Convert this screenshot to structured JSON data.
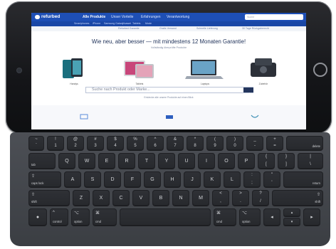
{
  "tablet": {
    "brand": "refurbed",
    "nav": [
      "Alle Produkte",
      "Unser Vorteile",
      "Erfahrungen",
      "Verantwortung"
    ],
    "search_placeholder": "Suche",
    "subnav": [
      "Smartphones",
      "iPhone",
      "Samsung Galaxy",
      "Huawei",
      "Tablets",
      "Mode"
    ],
    "pills": [
      "Refurbed Garantie",
      "Gratis Versand",
      "Schnelle Lieferung",
      "30 Tage Rückgaberecht"
    ],
    "headline": "Wie neu, aber besser — mit mindestens 12 Monaten Garantie!",
    "subheadline": "Vollständig überprüfte Produkte",
    "categories": [
      {
        "label": "Handys",
        "color": "#1a6f7e"
      },
      {
        "label": "Tablets",
        "color": "#c8467a"
      },
      {
        "label": "Laptops",
        "color": "#7f8a96"
      },
      {
        "label": "Zubehör",
        "color": "#2c3038"
      }
    ],
    "search_bar": "Suche nach Produkt oder Marke...",
    "hint": "Entdecke alle unsere Produkte auf einen Blick",
    "icon_colors": {
      "brand": "#1e4fb5",
      "text": "#23355c"
    }
  },
  "keyboard": {
    "row1": [
      {
        "top": "~",
        "bot": "`"
      },
      {
        "top": "!",
        "bot": "1"
      },
      {
        "top": "@",
        "bot": "2"
      },
      {
        "top": "#",
        "bot": "3"
      },
      {
        "top": "$",
        "bot": "4"
      },
      {
        "top": "%",
        "bot": "5"
      },
      {
        "top": "^",
        "bot": "6"
      },
      {
        "top": "&",
        "bot": "7"
      },
      {
        "top": "*",
        "bot": "8"
      },
      {
        "top": "(",
        "bot": "9"
      },
      {
        "top": ")",
        "bot": "0"
      },
      {
        "top": "_",
        "bot": "-"
      },
      {
        "top": "+",
        "bot": "="
      }
    ],
    "delete": "delete",
    "tab": "tab",
    "row2": [
      "Q",
      "W",
      "E",
      "R",
      "T",
      "Y",
      "U",
      "I",
      "O",
      "P"
    ],
    "row2_sym": [
      {
        "top": "{",
        "bot": "["
      },
      {
        "top": "}",
        "bot": "]"
      },
      {
        "top": "|",
        "bot": "\\"
      }
    ],
    "caps": "caps lock",
    "row3": [
      "A",
      "S",
      "D",
      "F",
      "G",
      "H",
      "J",
      "K",
      "L"
    ],
    "row3_sym": [
      {
        "top": ":",
        "bot": ";"
      },
      {
        "top": "\"",
        "bot": "'"
      }
    ],
    "return": "return",
    "shift": "shift",
    "row4": [
      "Z",
      "X",
      "C",
      "V",
      "B",
      "N",
      "M"
    ],
    "row4_sym": [
      {
        "top": "<",
        "bot": ","
      },
      {
        "top": ">",
        "bot": "."
      },
      {
        "top": "?",
        "bot": "/"
      }
    ],
    "shift_r": "shift",
    "control": "control",
    "option": "option",
    "cmd": "cmd",
    "cmd_r": "cmd",
    "option_r": "option"
  }
}
